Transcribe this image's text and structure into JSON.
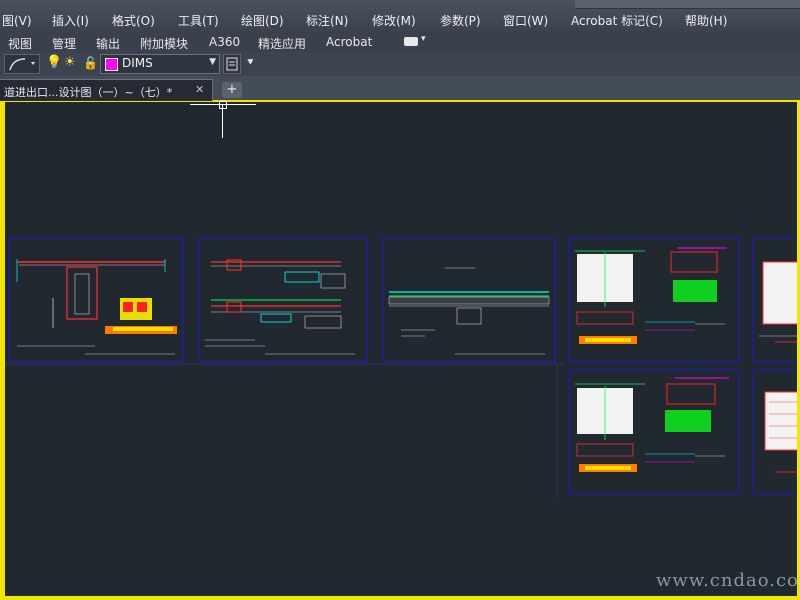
{
  "menubar": {
    "items": [
      "图(V)",
      "插入(I)",
      "格式(O)",
      "工具(T)",
      "绘图(D)",
      "标注(N)",
      "修改(M)",
      "参数(P)",
      "窗口(W)",
      "Acrobat 标记(C)",
      "帮助(H)"
    ]
  },
  "ribbon": {
    "tabs": [
      "视图",
      "管理",
      "输出",
      "附加模块",
      "A360",
      "精选应用",
      "Acrobat"
    ]
  },
  "toolbar": {
    "layer_name": "DIMS",
    "layer_color": "#ff00ff"
  },
  "doc_tabs": {
    "active_label": "道进出口...设计图（一）~（七）*",
    "new_tab_label": "+"
  },
  "canvas": {
    "background": "#212830",
    "sheet_border_color": "#1010d0"
  },
  "watermark": "www.cndao.com"
}
